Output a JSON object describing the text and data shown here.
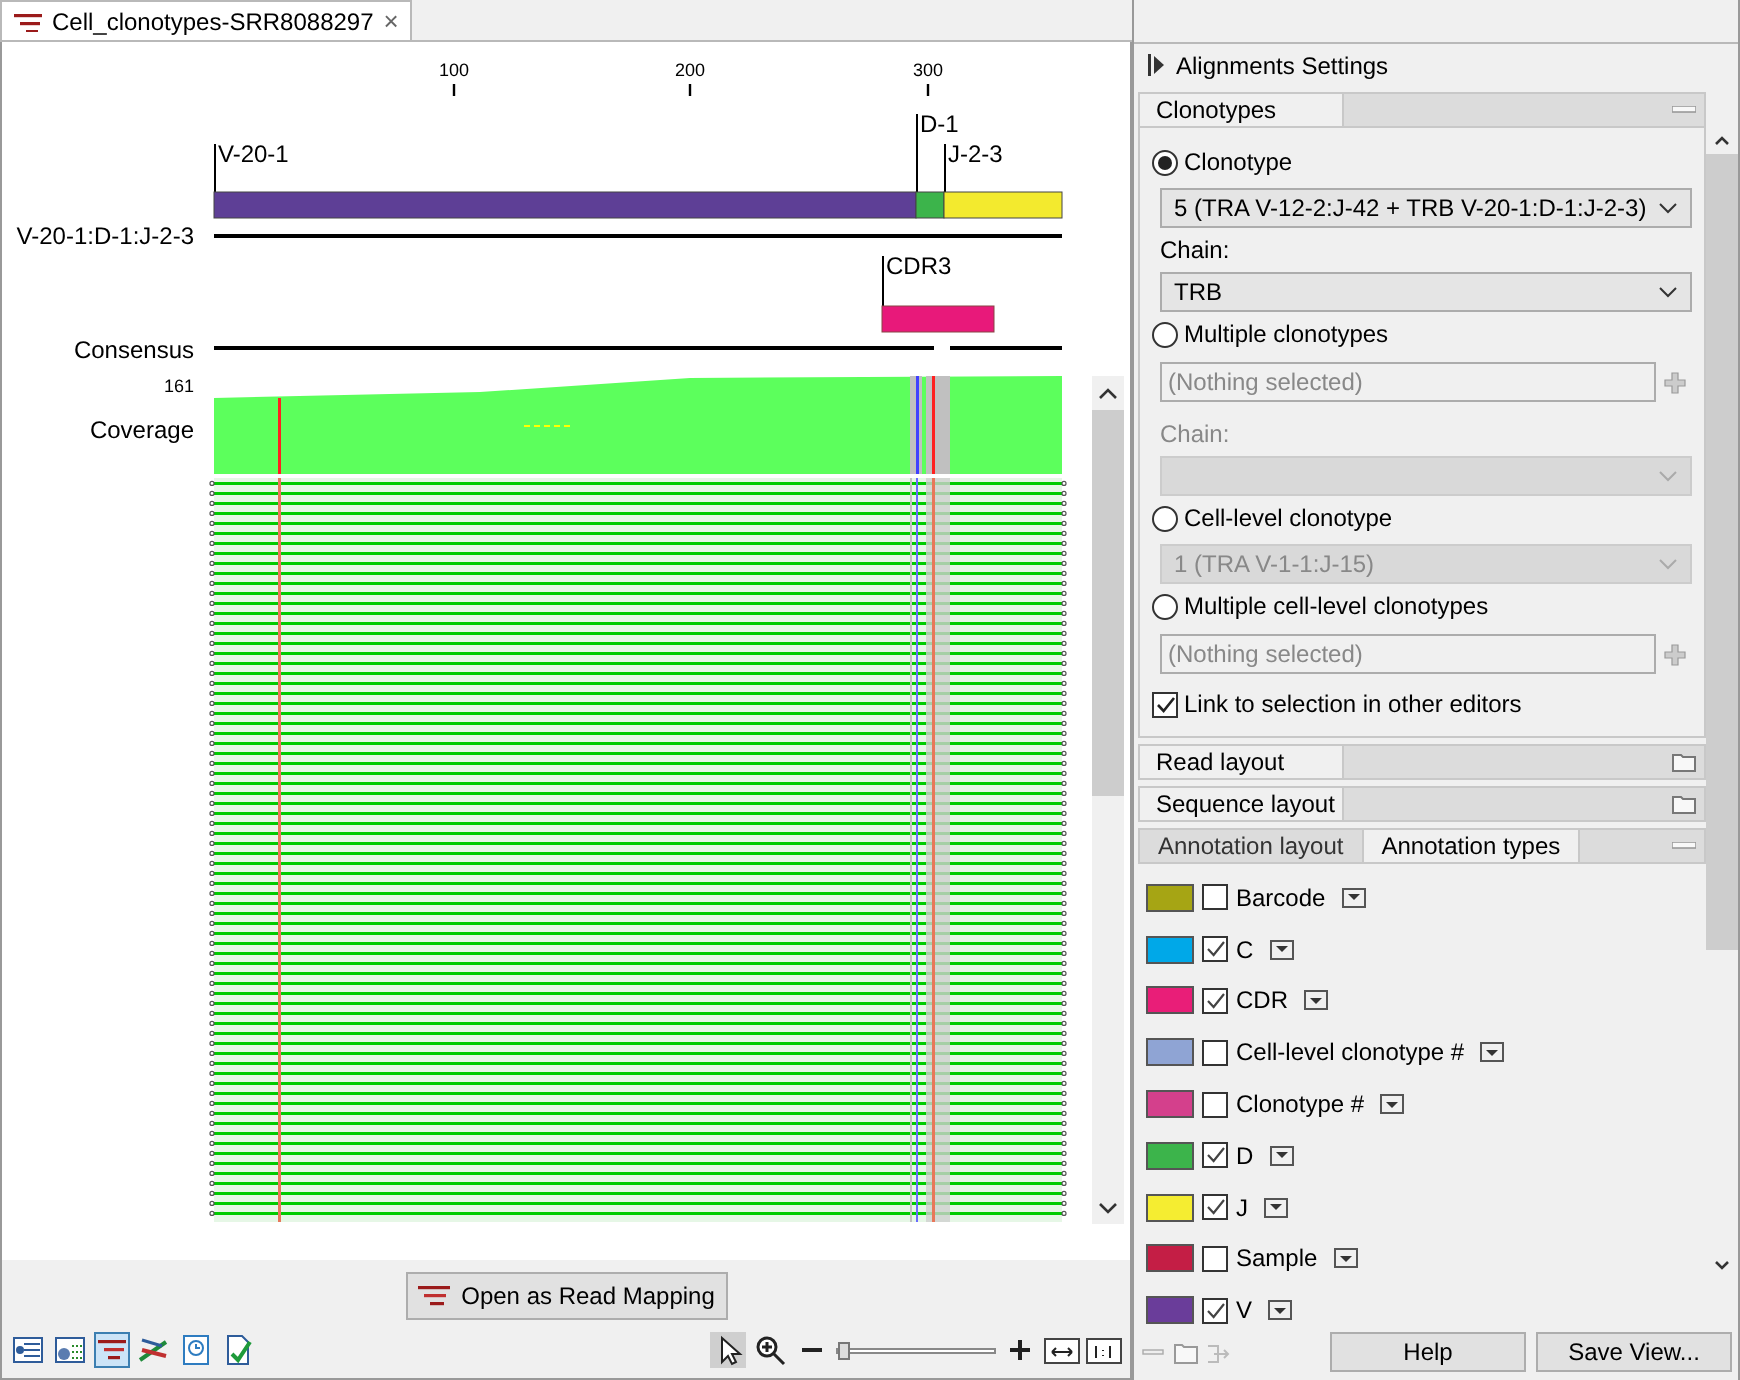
{
  "tab": {
    "title": "Cell_clonotypes-SRR8088297",
    "close": "×",
    "selected": true
  },
  "viewer": {
    "ruler_ticks": [
      "100",
      "200",
      "300"
    ],
    "gene_segments": [
      {
        "label": "V-20-1",
        "color": "#5e3f96"
      },
      {
        "label": "D-1",
        "color": "#3cb44b"
      },
      {
        "label": "J-2-3",
        "color": "#f3ea2e"
      }
    ],
    "segment_track_label": "V-20-1:D-1:J-2-3",
    "region": {
      "label": "CDR3",
      "color": "#e8197a"
    },
    "consensus_label": "Consensus",
    "coverage": {
      "max": "161",
      "label": "Coverage"
    }
  },
  "open_button": {
    "label": "Open as Read Mapping"
  },
  "view_toolbar": [
    {
      "selected": false
    },
    {
      "selected": false
    },
    {
      "selected": true
    },
    {
      "selected": false
    },
    {
      "selected": false
    },
    {
      "selected": false
    }
  ],
  "zoom": {
    "level": 0.02
  },
  "settings": {
    "title": "Alignments Settings",
    "clonotypes": {
      "title": "Clonotypes",
      "options": [
        {
          "kind": "radio",
          "label": "Clonotype",
          "selected": true
        },
        {
          "kind": "dropdown",
          "value": "5 (TRA V-12-2:J-42 + TRB V-20-1:D-1:J-2-3)",
          "disabled": false
        },
        {
          "kind": "label",
          "text": "Chain:",
          "disabled": false
        },
        {
          "kind": "dropdown",
          "value": "TRB",
          "disabled": false
        },
        {
          "kind": "radio",
          "label": "Multiple clonotypes",
          "selected": false
        },
        {
          "kind": "picker",
          "placeholder": "(Nothing selected)"
        },
        {
          "kind": "label",
          "text": "Chain:",
          "disabled": true
        },
        {
          "kind": "dropdown",
          "disabled": true
        },
        {
          "kind": "radio",
          "label": "Cell-level clonotype",
          "selected": false
        },
        {
          "kind": "dropdown",
          "value": "1 (TRA V-1-1:J-15)",
          "disabled": true
        },
        {
          "kind": "radio",
          "label": "Multiple cell-level clonotypes",
          "selected": false
        },
        {
          "kind": "picker",
          "placeholder": "(Nothing selected)"
        },
        {
          "kind": "checkbox",
          "label": "Link to selection in other editors",
          "checked": true
        }
      ]
    },
    "collapsed_sections": [
      "Read layout",
      "Sequence layout"
    ],
    "tabs": [
      {
        "label": "Annotation layout",
        "selected": false
      },
      {
        "label": "Annotation types",
        "selected": true
      }
    ],
    "annotation_types": [
      {
        "label": "Barcode",
        "color": "#a6a514",
        "checked": false
      },
      {
        "label": "C",
        "color": "#00a8e8",
        "checked": true
      },
      {
        "label": "CDR",
        "color": "#e91e78",
        "checked": true
      },
      {
        "label": "Cell-level clonotype #",
        "color": "#8fa4d4",
        "checked": false
      },
      {
        "label": "Clonotype #",
        "color": "#d4408c",
        "checked": false
      },
      {
        "label": "D",
        "color": "#3cb44b",
        "checked": true
      },
      {
        "label": "J",
        "color": "#f5ed31",
        "checked": true
      },
      {
        "label": "Sample",
        "color": "#c41e45",
        "checked": false
      },
      {
        "label": "V",
        "color": "#6a3d9a",
        "checked": true
      }
    ],
    "buttons": [
      "Help",
      "Save View..."
    ]
  }
}
